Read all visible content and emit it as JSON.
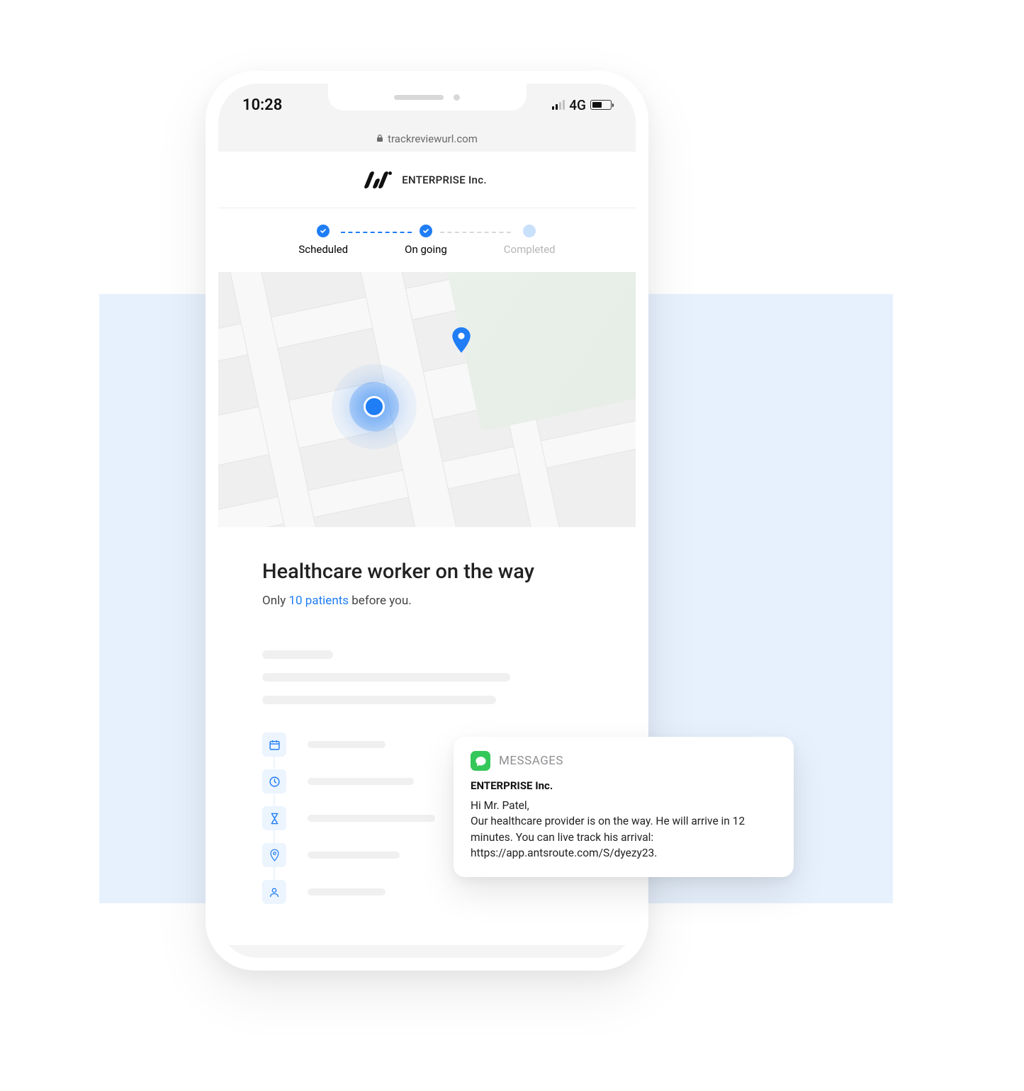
{
  "status_bar": {
    "time": "10:28",
    "network_label": "4G"
  },
  "browser": {
    "url": "trackreviewurl.com"
  },
  "company": {
    "name": "ENTERPRISE Inc."
  },
  "progress": {
    "steps": [
      {
        "label": "Scheduled",
        "state": "done"
      },
      {
        "label": "On going",
        "state": "done"
      },
      {
        "label": "Completed",
        "state": "future"
      }
    ]
  },
  "main": {
    "headline": "Healthcare worker on the way",
    "subline_before": "Only ",
    "subline_accent": "10 patients",
    "subline_after": " before you."
  },
  "detail_icons": [
    "calendar-icon",
    "clock-icon",
    "hourglass-icon",
    "pin-icon",
    "person-icon"
  ],
  "notification": {
    "app_name": "MESSAGES",
    "sender": "ENTERPRISE Inc.",
    "body": "Hi Mr. Patel,\nOur healthcare provider is on the way. He will arrive in 12 minutes. You can live track his arrival: https://app.antsroute.com/S/dyezy23."
  }
}
